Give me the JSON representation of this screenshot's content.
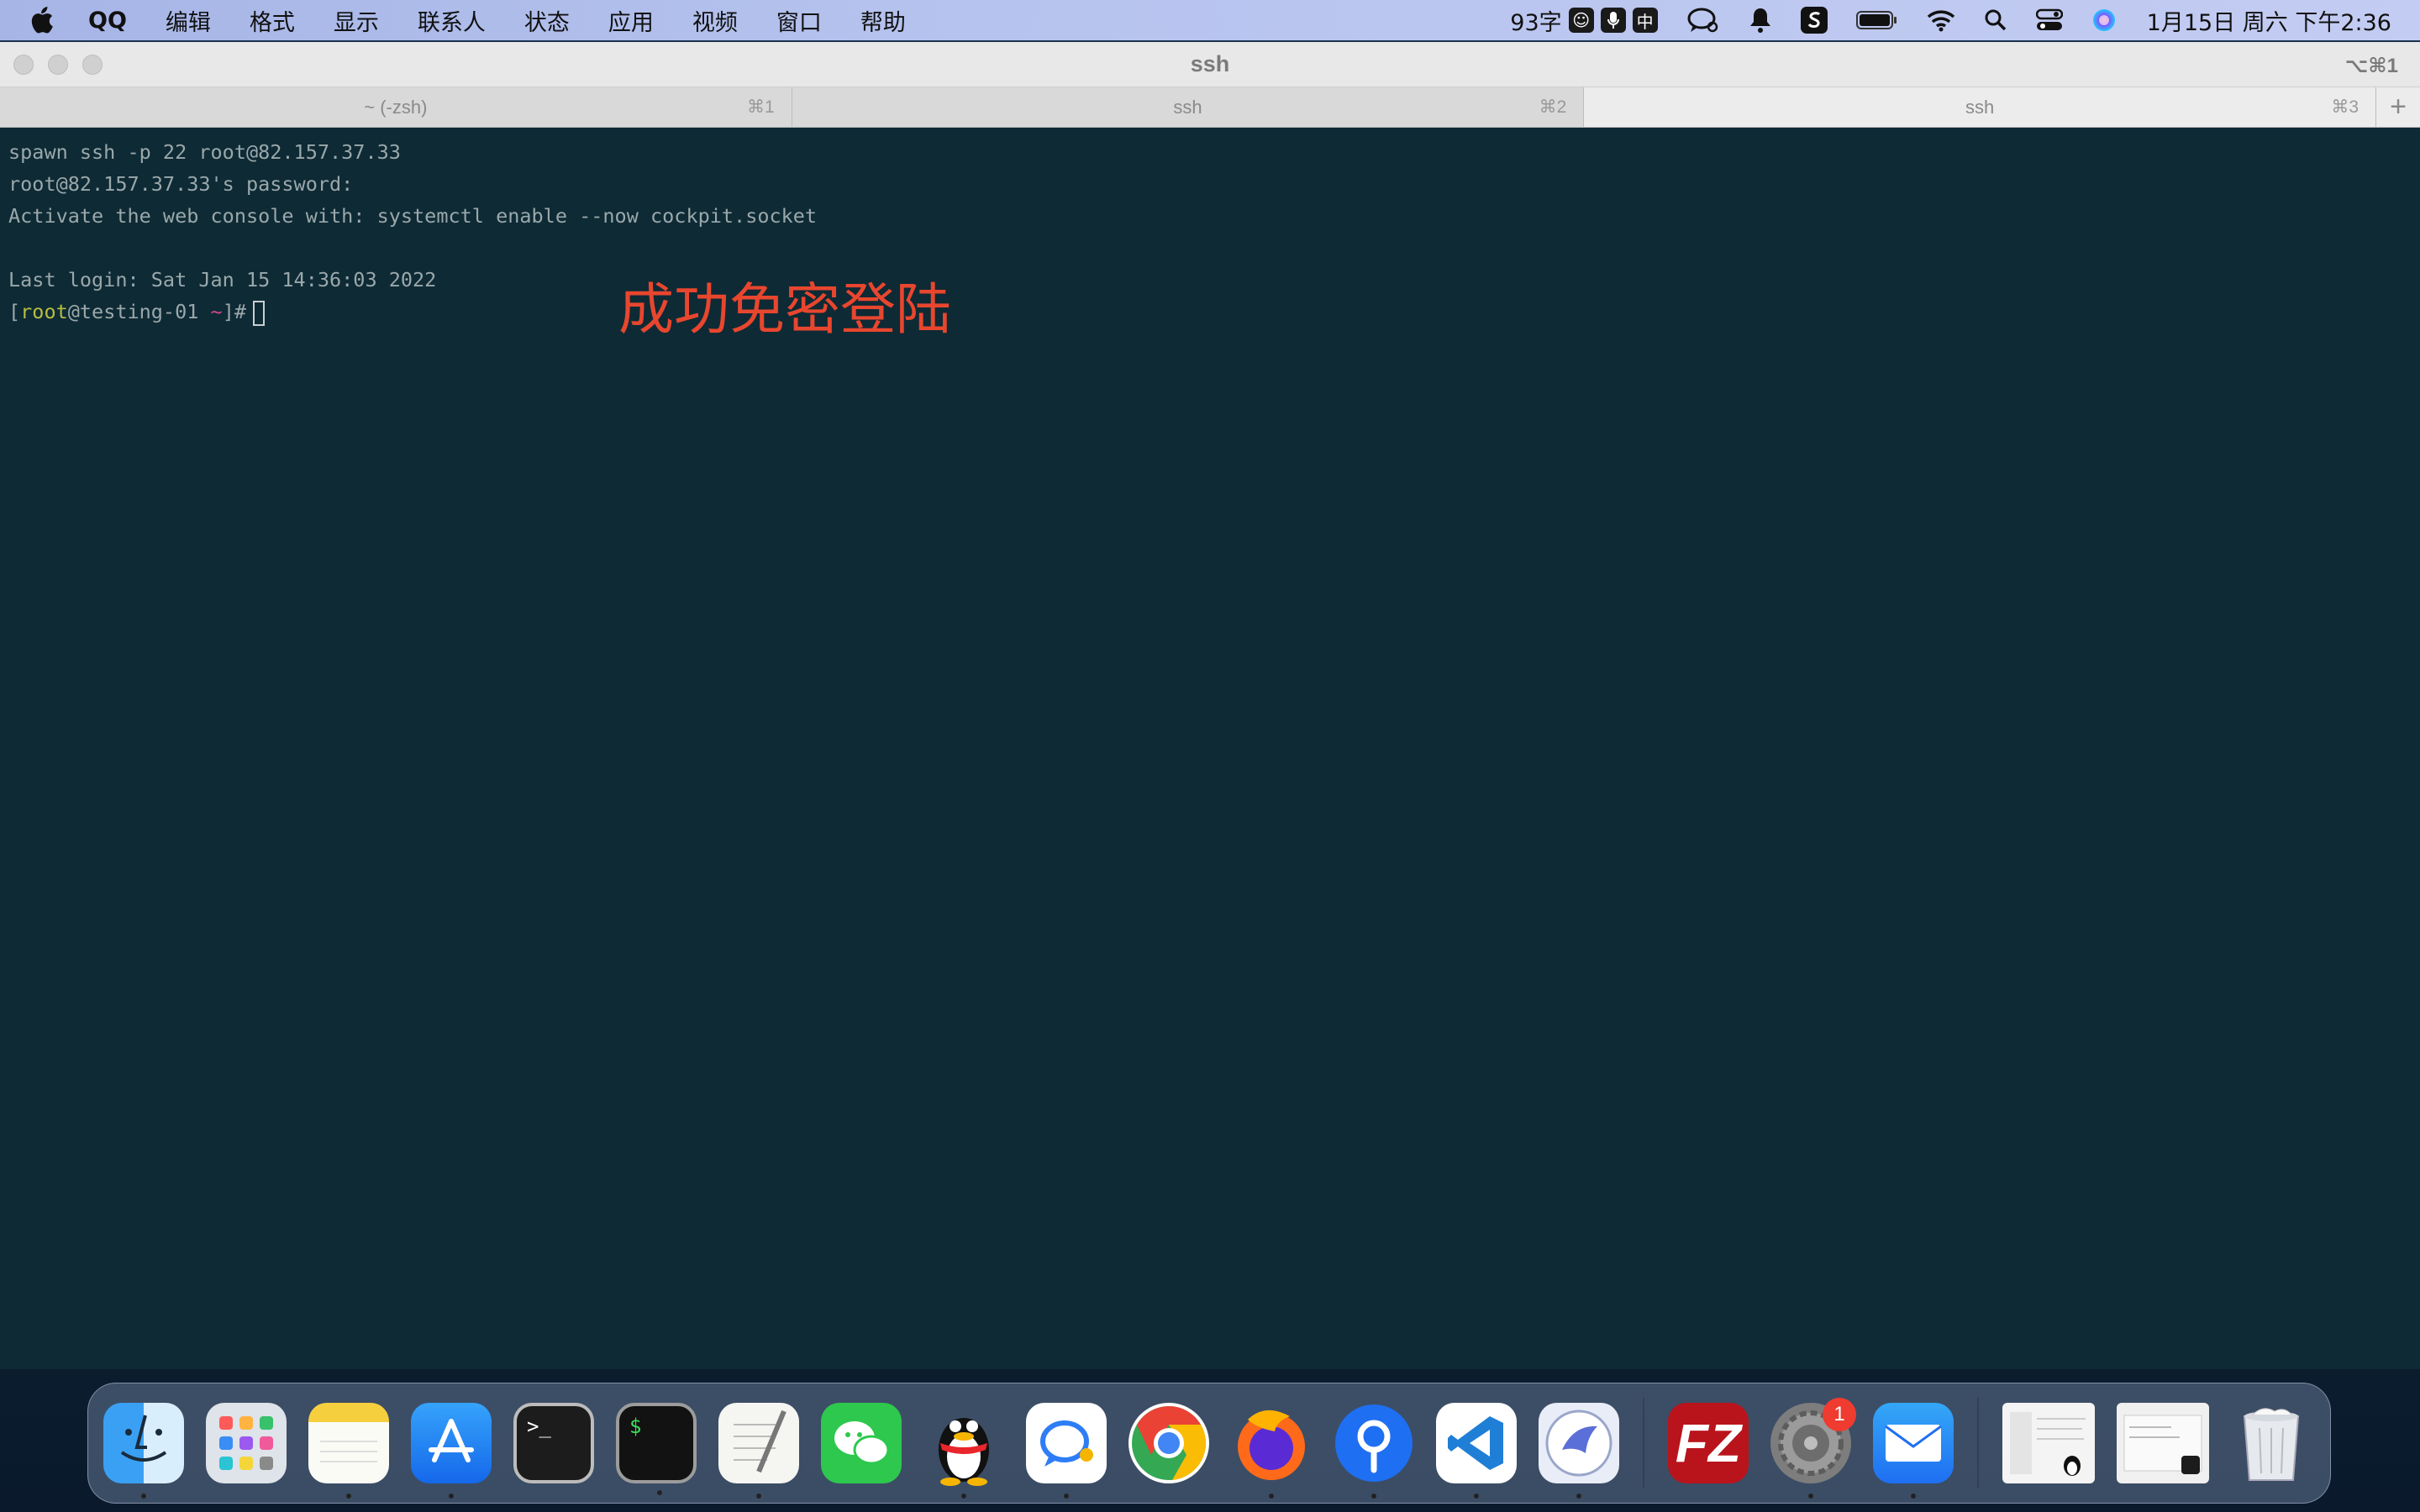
{
  "menubar": {
    "app": "QQ",
    "items": [
      "编辑",
      "格式",
      "显示",
      "联系人",
      "状态",
      "应用",
      "视频",
      "窗口",
      "帮助"
    ],
    "word_count": "93字",
    "input_method": "中",
    "clock": "1月15日 周六 下午2:36"
  },
  "window": {
    "title": "ssh",
    "shortcut": "⌥⌘1",
    "tabs": [
      {
        "label": "~ (-zsh)",
        "shortcut": "⌘1"
      },
      {
        "label": "ssh",
        "shortcut": "⌘2"
      },
      {
        "label": "ssh",
        "shortcut": "⌘3"
      }
    ],
    "add_tab": "+"
  },
  "terminal": {
    "lines": [
      "spawn ssh -p 22 root@82.157.37.33",
      "root@82.157.37.33's password:",
      "Activate the web console with: systemctl enable --now cockpit.socket",
      "",
      "Last login: Sat Jan 15 14:36:03 2022"
    ],
    "prompt": {
      "open": "[",
      "user": "root",
      "host": "@testing-01",
      "path": "~",
      "close": "]#"
    },
    "annotation": "成功免密登陆"
  },
  "dock": {
    "apps": [
      "finder-icon",
      "launchpad-icon",
      "notes-icon",
      "app-store-icon",
      "terminal-icon",
      "iterm-icon",
      "textedit-icon",
      "wechat-icon",
      "qq-icon",
      "chat-icon",
      "chrome-icon",
      "firefox-icon",
      "pin-icon",
      "vscode-icon",
      "lark-icon"
    ],
    "apps2": [
      "filezilla-icon",
      "system-preferences-icon",
      "mail-icon"
    ],
    "prefs_badge": "1",
    "terminal_glyph": ">_",
    "iterm_glyph": "$",
    "filezilla_glyph": "FZ"
  },
  "colors": {
    "terminal_bg": "#0e2a35",
    "annotation": "#e8462e",
    "prompt_user": "#b7bd3f",
    "prompt_tilde": "#d04a84"
  }
}
